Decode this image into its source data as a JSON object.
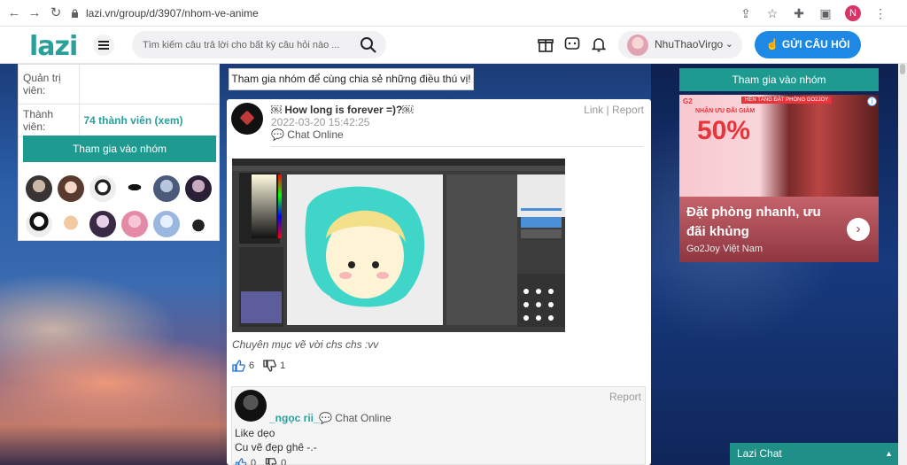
{
  "browser": {
    "url": "lazi.vn/group/d/3907/nhom-ve-anime",
    "profile_initial": "N"
  },
  "header": {
    "logo": "lazi",
    "search_placeholder": "Tìm kiếm câu trả lời cho bất kỳ câu hỏi nào ...",
    "username": "NhuThaoVirgo",
    "ask_button": "GỬI CÂU HỎI"
  },
  "left_panel": {
    "admin_label": "Quản trị viên:",
    "admin_value": "",
    "members_label": "Thành viên:",
    "members_value": "74 thành viên (xem)",
    "join_button": "Tham gia vào nhóm"
  },
  "center": {
    "cta": "Tham gia nhóm để cùng chia sẻ những điều thú vị!",
    "post": {
      "title": "￼ How long is forever =)?￼",
      "date": "2022-03-20 15:42:25",
      "status": "Chat Online",
      "link_label": "Link",
      "report_label": "Report",
      "caption": "Chuyên mục vẽ vời chs chs :vv",
      "likes": "6",
      "dislikes": "1"
    },
    "comment": {
      "author": "_ngọc rii_",
      "status": "Chat Online",
      "report_label": "Report",
      "line1": "Like dẹo",
      "line2": "Cu vẽ đẹp ghê -.-",
      "likes": "0",
      "dislikes": "0"
    }
  },
  "right_panel": {
    "join_button": "Tham gia vào nhóm",
    "ad": {
      "brand": "G2",
      "top_label": "HÈN TĂNG ĐẶT PHÒNG GO2JOY",
      "small_label": "NHẬN ƯU ĐÃI GIẢM",
      "percent": "50%",
      "headline": "Đặt phòng nhanh, ưu đãi khủng",
      "sub": "Go2Joy Việt Nam"
    }
  },
  "chat_bar": {
    "label": "Lazi Chat"
  },
  "colors": {
    "teal": "#1f9a91",
    "blue": "#1e88e5",
    "member_link": "#2aa09b"
  }
}
